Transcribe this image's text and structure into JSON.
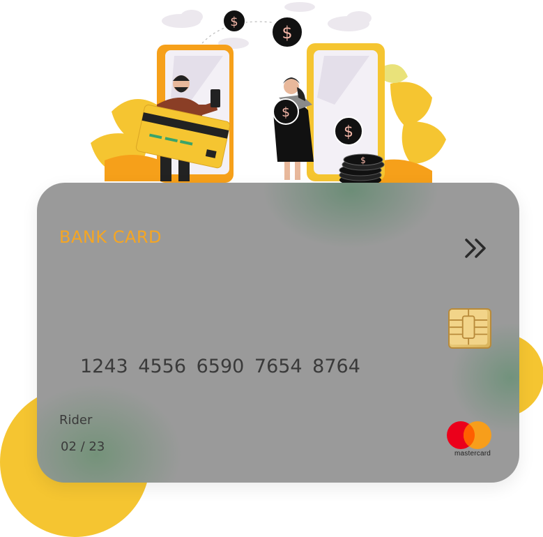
{
  "card": {
    "label": "BANK CARD",
    "number": "1243 4556 6590 7654 8764",
    "holder": "Rider",
    "expiry": "02 / 23",
    "brand": "mastercard"
  },
  "icons": {
    "chevrons": "double-chevron-right-icon",
    "chip": "card-chip-icon",
    "brand_logo": "mastercard-logo-icon",
    "coin": "dollar-coin-icon"
  },
  "colors": {
    "accent": "#f5a623",
    "card_background": "#9a9a9a",
    "mastercard_red": "#eb001b",
    "mastercard_orange": "#f79e1b",
    "yellow_shape": "#f5c531"
  }
}
